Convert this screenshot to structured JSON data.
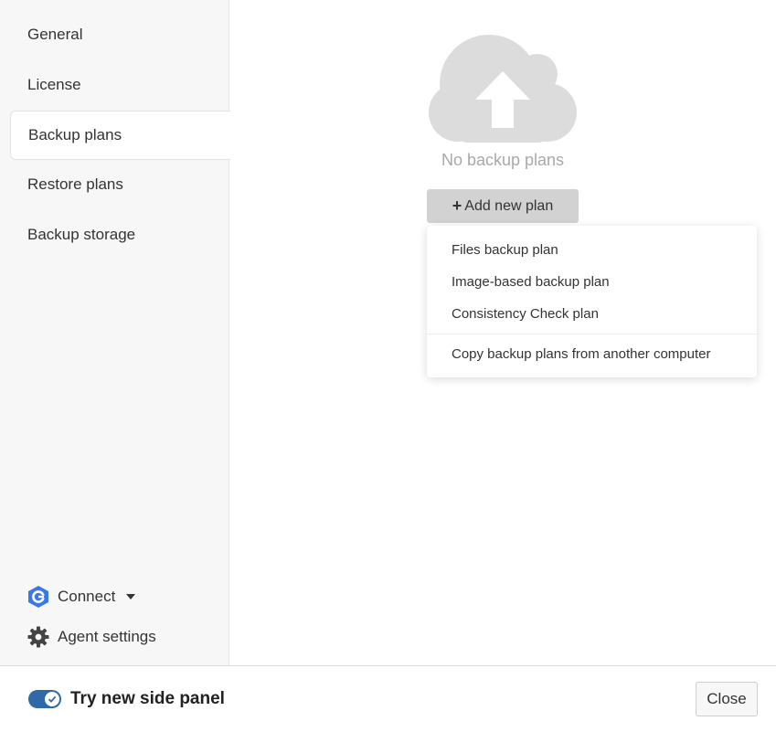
{
  "sidebar": {
    "items": [
      {
        "label": "General",
        "active": false
      },
      {
        "label": "License",
        "active": false
      },
      {
        "label": "Backup plans",
        "active": true
      },
      {
        "label": "Restore plans",
        "active": false
      },
      {
        "label": "Backup storage",
        "active": false
      }
    ],
    "connect_label": "Connect",
    "agent_settings_label": "Agent settings"
  },
  "main": {
    "empty_state_text": "No backup plans",
    "add_button_label": "Add new plan",
    "menu": {
      "items": [
        "Files backup plan",
        "Image-based backup plan",
        "Consistency Check plan",
        "Copy backup plans from another computer"
      ]
    }
  },
  "footer": {
    "toggle_label": "Try new side panel",
    "toggle_on": true,
    "close_label": "Close"
  },
  "colors": {
    "accent": "#2f6aa8",
    "cloud": "#dcdcdc",
    "connect_icon": "#3b78e7"
  },
  "icons": [
    "cloud-upload-icon",
    "plus-icon",
    "connect-logo-icon",
    "chevron-down-icon",
    "gear-icon",
    "check-icon"
  ]
}
